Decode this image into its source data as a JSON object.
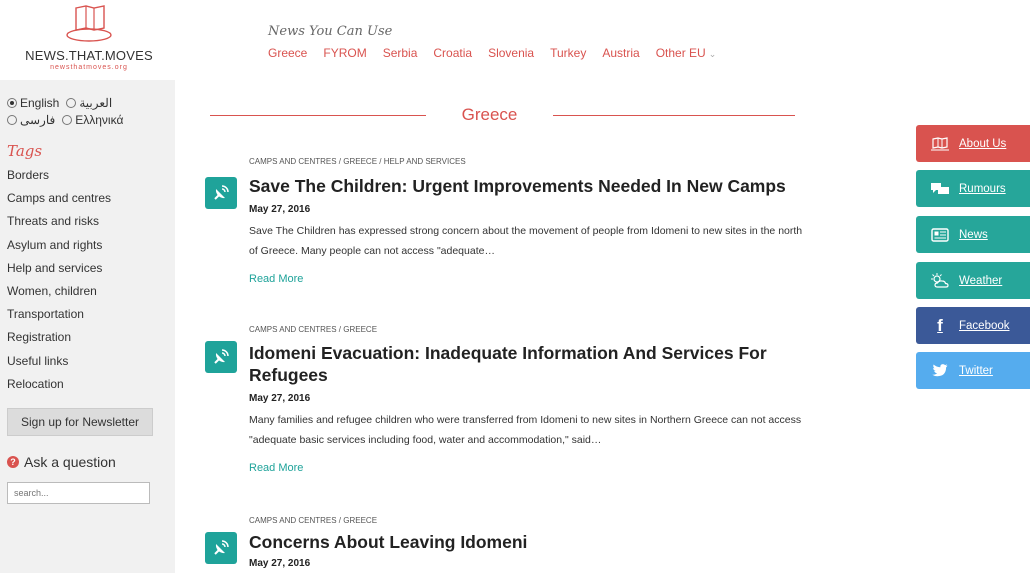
{
  "site": {
    "logo_title": "NEWS.THAT.MOVES",
    "logo_sub": "newsthatmoves.org",
    "tagline": "News You Can Use"
  },
  "topnav": [
    {
      "label": "Greece"
    },
    {
      "label": "FYROM"
    },
    {
      "label": "Serbia"
    },
    {
      "label": "Croatia"
    },
    {
      "label": "Slovenia"
    },
    {
      "label": "Turkey"
    },
    {
      "label": "Austria"
    },
    {
      "label": "Other EU"
    }
  ],
  "languages": {
    "english": "English",
    "arabic": "العربية",
    "farsi": "فارسی",
    "greek": "Ελληνικά",
    "selected": "English"
  },
  "sidebar": {
    "tags_title": "Tags",
    "tags": [
      "Borders",
      "Camps and centres",
      "Threats and risks",
      "Asylum and rights",
      "Help and services",
      "Women, children",
      "Transportation",
      "Registration",
      "Useful links",
      "Relocation"
    ],
    "newsletter_label": "Sign up for Newsletter",
    "ask_label": "Ask a question",
    "search_placeholder": "search..."
  },
  "main": {
    "section_title": "Greece",
    "articles": [
      {
        "crumbs": "CAMPS AND CENTRES / GREECE / HELP AND SERVICES",
        "title": "Save The Children: Urgent Improvements Needed In New Camps",
        "date": "May 27, 2016",
        "excerpt": "Save The Children has expressed strong concern about the movement of people from Idomeni to new sites in the north of Greece. Many people can not access \"adequate…",
        "read_more": "Read More"
      },
      {
        "crumbs": "CAMPS AND CENTRES / GREECE",
        "title": "Idomeni Evacuation: Inadequate Information And Services For Refugees",
        "date": "May 27, 2016",
        "excerpt": "Many families and refugee children who were transferred from Idomeni to new sites in Northern Greece can not access \"adequate basic services including food, water and accommodation,\" said…",
        "read_more": "Read More"
      },
      {
        "crumbs": "CAMPS AND CENTRES / GREECE",
        "title": "Concerns About Leaving Idomeni",
        "date": "May 27, 2016"
      }
    ]
  },
  "side_buttons": [
    {
      "label": "About Us",
      "color": "#d9534f",
      "icon": "map-icon"
    },
    {
      "label": "Rumours",
      "color": "#26a69a",
      "icon": "chat-icon"
    },
    {
      "label": "News",
      "color": "#26a69a",
      "icon": "newspaper-icon"
    },
    {
      "label": "Weather",
      "color": "#26a69a",
      "icon": "weather-icon"
    },
    {
      "label": "Facebook",
      "color": "#3b5998",
      "icon": "facebook-icon"
    },
    {
      "label": "Twitter",
      "color": "#55acee",
      "icon": "twitter-icon"
    }
  ]
}
